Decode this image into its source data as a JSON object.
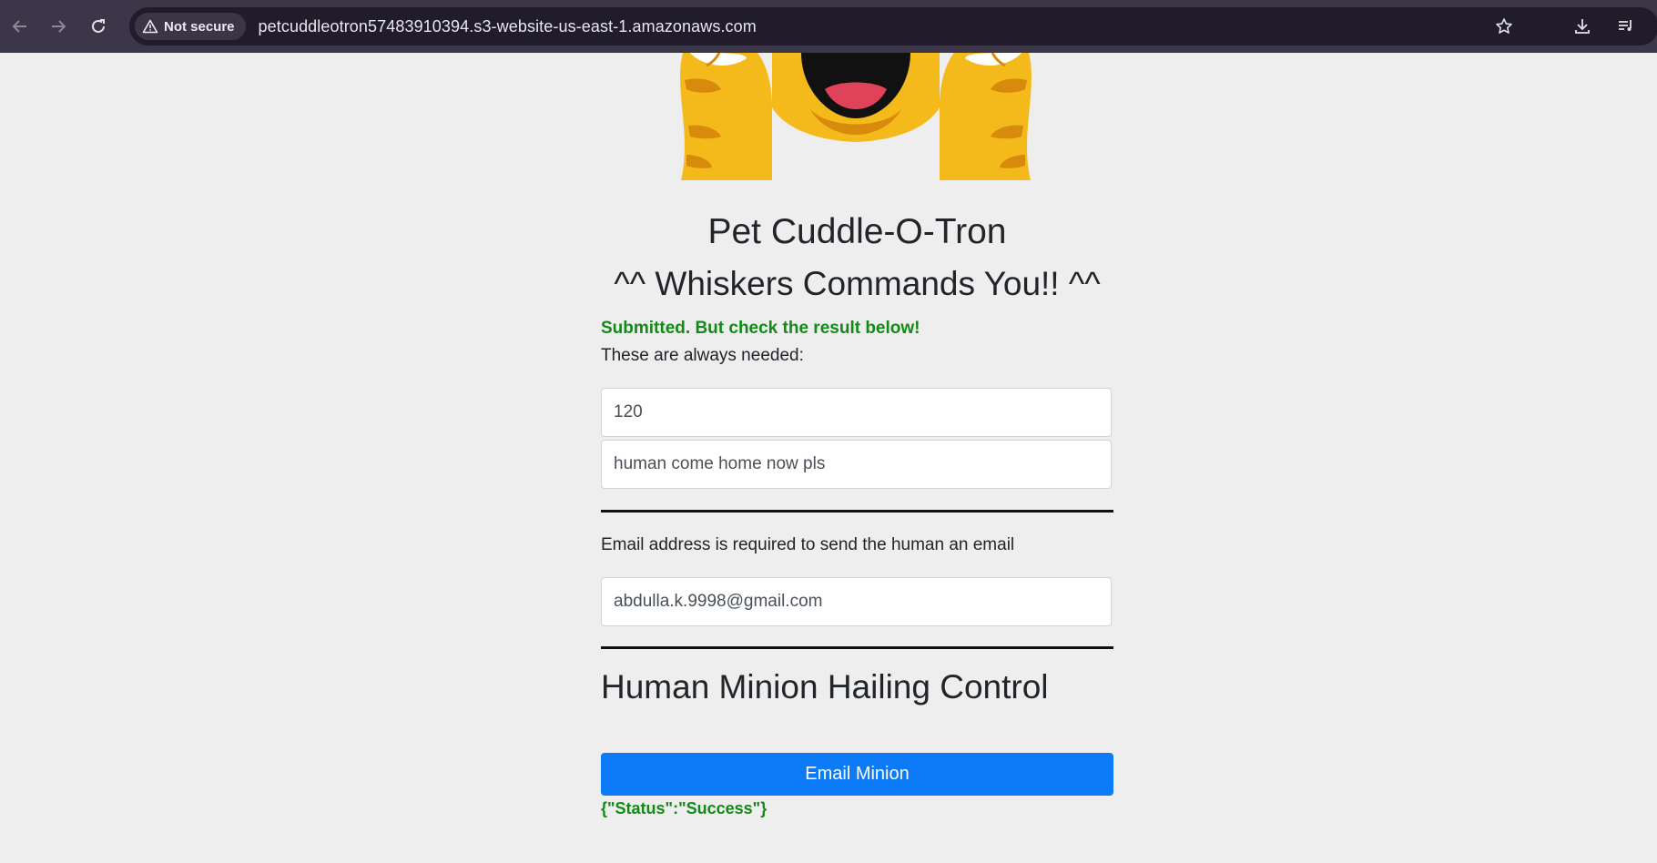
{
  "browser": {
    "security_label": "Not secure",
    "url": "petcuddleotron57483910394.s3-website-us-east-1.amazonaws.com"
  },
  "page": {
    "title": "Pet Cuddle-O-Tron",
    "subtitle": "^^ Whiskers Commands You!! ^^",
    "submitted_message": "Submitted. But check the result below!",
    "always_needed_label": "These are always needed:",
    "delay_value": "120",
    "message_value": "human come home now pls",
    "email_label": "Email address is required to send the human an email",
    "email_value": "abdulla.k.9998@gmail.com",
    "section_heading": "Human Minion Hailing Control",
    "email_button_label": "Email Minion",
    "status_result": "{\"Status\":\"Success\"}"
  },
  "colors": {
    "chrome_bg": "#3c3649",
    "omnibox_bg": "#201c2b",
    "page_bg": "#eeeeee",
    "success_green": "#138a18",
    "button_blue": "#0d7af8"
  }
}
